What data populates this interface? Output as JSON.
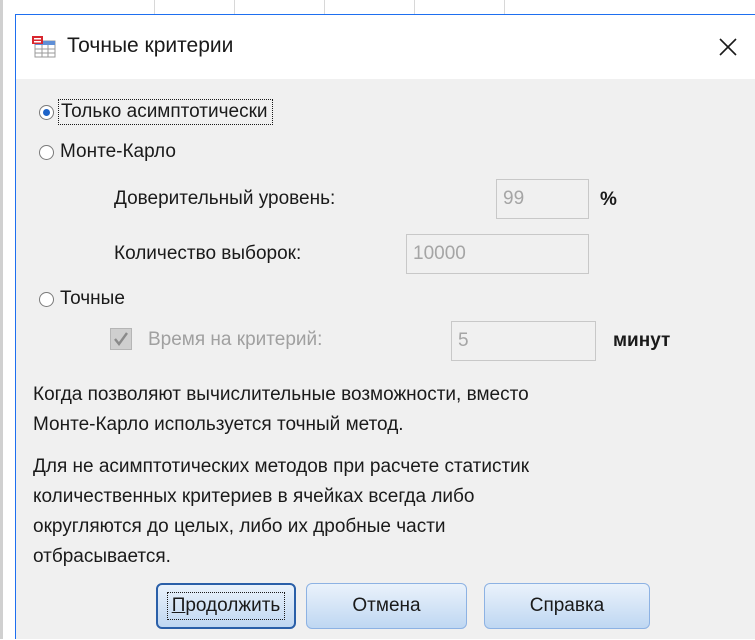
{
  "dialog": {
    "title": "Точные критерии",
    "title_icon": "spss-table-icon",
    "close_icon": "close-icon"
  },
  "methods": {
    "asymptotic": {
      "label": "Только асимптотически",
      "checked": true
    },
    "monte_carlo": {
      "label": "Монте-Карло",
      "checked": false
    },
    "exact": {
      "label": "Точные",
      "checked": false
    }
  },
  "monte_carlo_options": {
    "confidence_label": "Доверительный уровень:",
    "confidence_value": "99",
    "confidence_unit": "%",
    "samples_label": "Количество выборок:",
    "samples_value": "10000"
  },
  "exact_options": {
    "time_limit_label": "Время на критерий:",
    "time_limit_checked": true,
    "time_limit_value": "5",
    "time_limit_unit": "минут"
  },
  "notes": {
    "paragraph1_line1": "Когда позволяют вычислительные возможности, вместо",
    "paragraph1_line2": "Монте-Карло используется точный метод.",
    "paragraph2_line1": "Для не асимптотических методов при расчете статистик",
    "paragraph2_line2": "количественных критериев в ячейках всегда либо",
    "paragraph2_line3": "округляются до целых, либо их дробные части",
    "paragraph2_line4": "отбрасывается."
  },
  "buttons": {
    "continue_underline": "П",
    "continue_rest": "родолжить",
    "cancel": "Отмена",
    "help": "Справка"
  },
  "colors": {
    "accent": "#1e6ff0",
    "button_default_border": "#2a5fa8",
    "disabled_text": "#a0a0a0"
  }
}
